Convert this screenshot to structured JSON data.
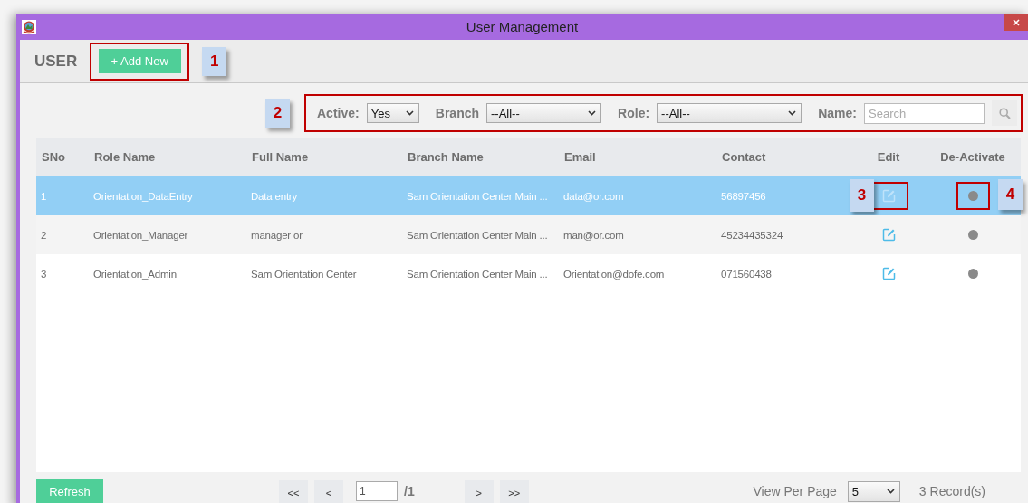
{
  "window": {
    "title": "User Management"
  },
  "toolbar": {
    "heading": "USER",
    "add_button": {
      "label": "+ Add New",
      "callout": "1"
    }
  },
  "filters": {
    "callout": "2",
    "active": {
      "label": "Active:",
      "value": "Yes"
    },
    "branch": {
      "label": "Branch",
      "value": "--All--"
    },
    "role": {
      "label": "Role:",
      "value": "--All--"
    },
    "name": {
      "label": "Name:",
      "placeholder": "Search"
    }
  },
  "table": {
    "columns": [
      "SNo",
      "Role Name",
      "Full Name",
      "Branch Name",
      "Email",
      "Contact",
      "Edit",
      "De-Activate"
    ],
    "rows": [
      {
        "sno": "1",
        "role": "Orientation_DataEntry",
        "full_name": "Data entry",
        "branch": "Sam Orientation Center Main ...",
        "email": "data@or.com",
        "contact": "56897456",
        "selected": true,
        "edit_callout": "3",
        "deactivate_callout": "4"
      },
      {
        "sno": "2",
        "role": "Orientation_Manager",
        "full_name": "manager or",
        "branch": "Sam Orientation Center Main ...",
        "email": "man@or.com",
        "contact": "45234435324",
        "selected": false
      },
      {
        "sno": "3",
        "role": "Orientation_Admin",
        "full_name": "Sam Orientation Center",
        "branch": "Sam Orientation Center Main ...",
        "email": "Orientation@dofe.com",
        "contact": "071560438",
        "selected": false
      }
    ]
  },
  "footer": {
    "refresh": "Refresh",
    "first": "<<",
    "prev": "<",
    "page": "1",
    "total": "/1",
    "next": ">",
    "last": ">>",
    "view_per_page_label": "View Per Page",
    "view_per_page": "5",
    "records": "3 Record(s)"
  }
}
